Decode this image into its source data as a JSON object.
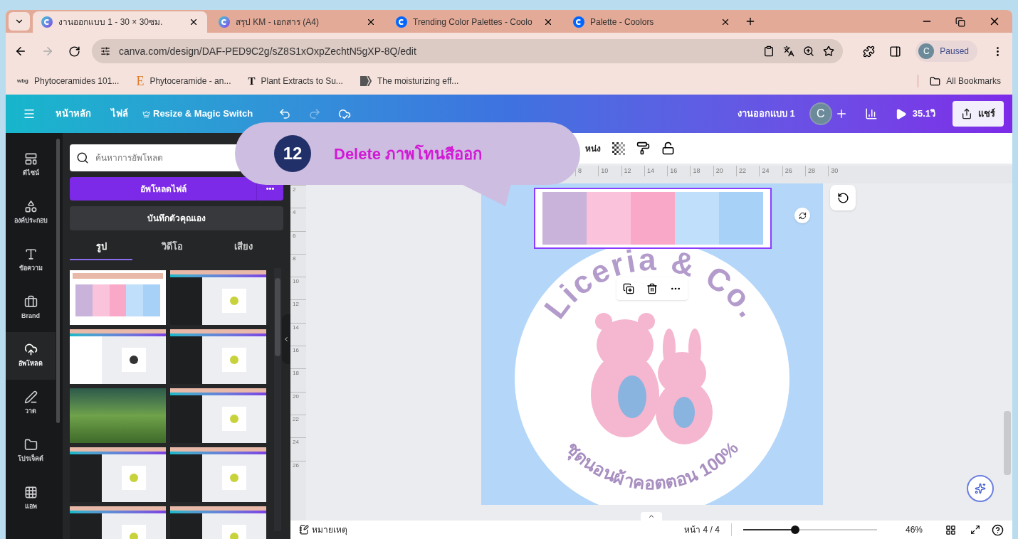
{
  "browser": {
    "tabs": [
      {
        "title": "งานออกแบบ 1 - 30 × 30ซม.",
        "kind": "canva",
        "selected": true
      },
      {
        "title": "สรุป KM - เอกสาร (A4)",
        "kind": "canva",
        "selected": false
      },
      {
        "title": "Trending Color Palettes - Coolo",
        "kind": "coolors",
        "selected": false
      },
      {
        "title": "Palette - Coolors",
        "kind": "coolors",
        "selected": false
      }
    ],
    "url": "canva.com/design/DAF-PED9C2g/sZ8S1xOxpZechtN5gXP-8Q/edit",
    "profile": {
      "initial": "C",
      "status": "Paused"
    },
    "bookmarks": [
      {
        "label": "Phytoceramides 101...",
        "kind": "text",
        "favicon_text": "wbg"
      },
      {
        "label": "Phytoceramide - an...",
        "kind": "letter",
        "favicon_text": "E"
      },
      {
        "label": "Plant Extracts to Su...",
        "kind": "bold",
        "favicon_text": "T"
      },
      {
        "label": "The moisturizing eff...",
        "kind": "shape"
      }
    ],
    "all_bookmarks": "All Bookmarks"
  },
  "header": {
    "menu": [
      "หน้าหลัก",
      "ไฟล์"
    ],
    "resize": "Resize & Magic Switch",
    "title": "งานออกแบบ 1",
    "avatar": "C",
    "timer": "35.1วิ",
    "share": "แชร์"
  },
  "rail": [
    {
      "label": "ดีไซน์",
      "selected": false
    },
    {
      "label": "องค์ประกอบ",
      "selected": false
    },
    {
      "label": "ข้อความ",
      "selected": false
    },
    {
      "label": "Brand",
      "selected": false
    },
    {
      "label": "อัพโหลด",
      "selected": true
    },
    {
      "label": "วาด",
      "selected": false
    },
    {
      "label": "โปรเจ็คต์",
      "selected": false
    },
    {
      "label": "แอพ",
      "selected": false
    }
  ],
  "panel": {
    "search": {
      "placeholder": "ค้นหาการอัพโหลด"
    },
    "upload": "อัพโหลดไฟล์",
    "more": "•••",
    "record": "บันทึกตัวคุณเอง",
    "media_tabs": [
      {
        "label": "รูป",
        "selected": true
      },
      {
        "label": "วิดีโอ",
        "selected": false
      },
      {
        "label": "เสียง",
        "selected": false
      }
    ],
    "thumbnails": [
      {
        "kind": "palette"
      },
      {
        "kind": "dark"
      },
      {
        "kind": "light"
      },
      {
        "kind": "dark"
      },
      {
        "kind": "photo"
      },
      {
        "kind": "dark"
      },
      {
        "kind": "dark"
      },
      {
        "kind": "dark"
      },
      {
        "kind": "dark"
      },
      {
        "kind": "dark"
      }
    ]
  },
  "callout": {
    "step": "12",
    "text": "Delete ภาพโทนสีออก"
  },
  "toolbar": {
    "position": "หน่ง"
  },
  "ruler": {
    "horizontal": [
      "8",
      "10",
      "12",
      "14",
      "16",
      "18",
      "20",
      "22",
      "24",
      "26",
      "28",
      "30"
    ],
    "vertical": [
      "2",
      "4",
      "6",
      "8",
      "10",
      "12",
      "14",
      "16",
      "18",
      "20",
      "22",
      "24",
      "26"
    ]
  },
  "design": {
    "palette": [
      {
        "color": "#c9b3da"
      },
      {
        "color": "#fbc3db"
      },
      {
        "color": "#f9a8c7"
      },
      {
        "color": "#bfdffb"
      },
      {
        "color": "#a8d1f8"
      }
    ],
    "brand": "Liceria & Co.",
    "tagline": "ชุดนอนผ้าคอตตอน 100%"
  },
  "footer": {
    "notes": "หมายเหตุ",
    "page": "หน้า 4 / 4",
    "zoom": {
      "level": 0.39
    },
    "zoom_text": "46%"
  }
}
